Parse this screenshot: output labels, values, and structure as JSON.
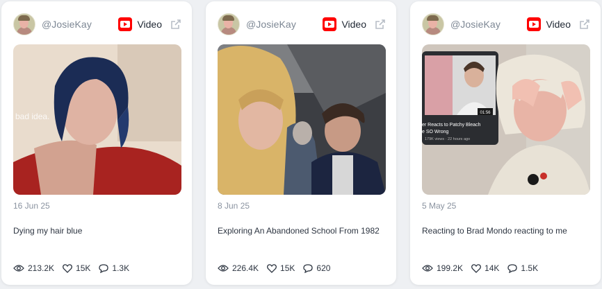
{
  "cards": [
    {
      "handle": "@JosieKay",
      "type_label": "Video",
      "thumb_overlay_text": "bad idea.",
      "date": "16 Jun 25",
      "title": "Dying my hair blue",
      "views": "213.2K",
      "likes": "15K",
      "comments": "1.3K"
    },
    {
      "handle": "@JosieKay",
      "type_label": "Video",
      "date": "8 Jun 25",
      "title": "Exploring An Abandoned School From 1982",
      "views": "226.4K",
      "likes": "15K",
      "comments": "620"
    },
    {
      "handle": "@JosieKay",
      "type_label": "Video",
      "inset": {
        "title_line1": "er Reacts to Patchy Bleach",
        "title_line2": "e SO Wrong",
        "meta": "179K views · 22 hours ago",
        "duration": "01:56"
      },
      "date": "5 May 25",
      "title": "Reacting to Brad Mondo reacting to me",
      "views": "199.2K",
      "likes": "14K",
      "comments": "1.5K"
    }
  ],
  "colors": {
    "background": "#eef0f3",
    "card": "#ffffff",
    "youtube_red": "#ff0000",
    "muted_text": "#8a93a0"
  },
  "icons": [
    "avatar",
    "youtube-icon",
    "external-link-icon",
    "eye-icon",
    "heart-icon",
    "comment-icon"
  ]
}
